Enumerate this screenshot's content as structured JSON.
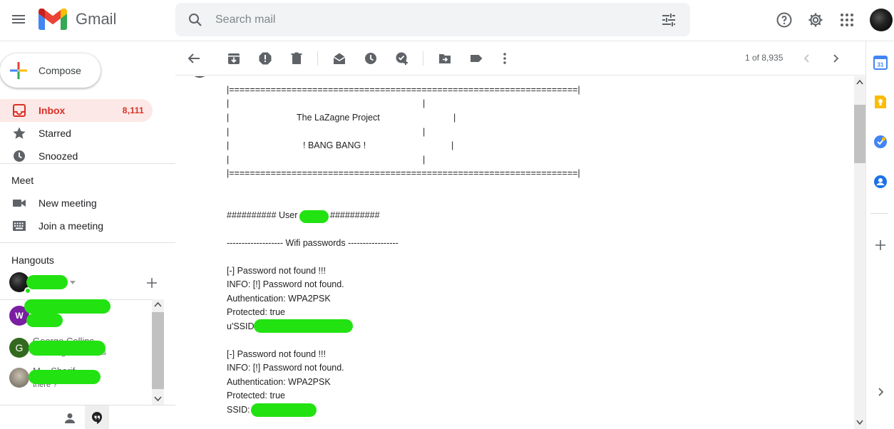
{
  "header": {
    "app_name": "Gmail",
    "search_placeholder": "Search mail"
  },
  "left": {
    "compose_label": "Compose",
    "nav": [
      {
        "label": "Inbox",
        "count": "8,111",
        "icon": "inbox-icon"
      },
      {
        "label": "Starred",
        "icon": "star-icon"
      },
      {
        "label": "Snoozed",
        "icon": "clock-icon"
      }
    ],
    "meet": {
      "title": "Meet",
      "items": [
        {
          "label": "New meeting",
          "icon": "video-icon"
        },
        {
          "label": "Join a meeting",
          "icon": "keyboard-icon"
        }
      ]
    },
    "hangouts": {
      "title": "Hangouts",
      "chats": [
        {
          "initial": "W",
          "color": "#7b1fa2"
        },
        {
          "initial": "G",
          "color": "#33691e",
          "name": "George Collins",
          "snippet": "You: Alright ... thanks"
        },
        {
          "initial": "",
          "color": "#9e9e9e",
          "name": "M... Sharif...",
          "snippet": "there ?"
        }
      ]
    }
  },
  "toolbar": {
    "pager": "1 of 8,935"
  },
  "email": {
    "lines": [
      "|===================================================================|",
      "|                                                                   |",
      "|                        The LaZagne Project                        |",
      "|                                                                   |",
      "|                          ! BANG BANG !                            |",
      "|                                                                   |",
      "|===================================================================|",
      "",
      "",
      "########## User",
      "##########",
      "------------------- Wifi passwords -----------------",
      "",
      "[-] Password not found !!!",
      "INFO: [!] Password not found.",
      "Authentication: WPA2PSK",
      "Protected: true",
      "u'SSID",
      "",
      "[-] Password not found !!!",
      "INFO: [!] Password not found.",
      "Authentication: WPA2PSK",
      "Protected: true",
      "SSID:"
    ]
  },
  "colors": {
    "accent_red": "#d93025",
    "inbox_bg": "#fce8e6",
    "redaction": "#22e212"
  }
}
